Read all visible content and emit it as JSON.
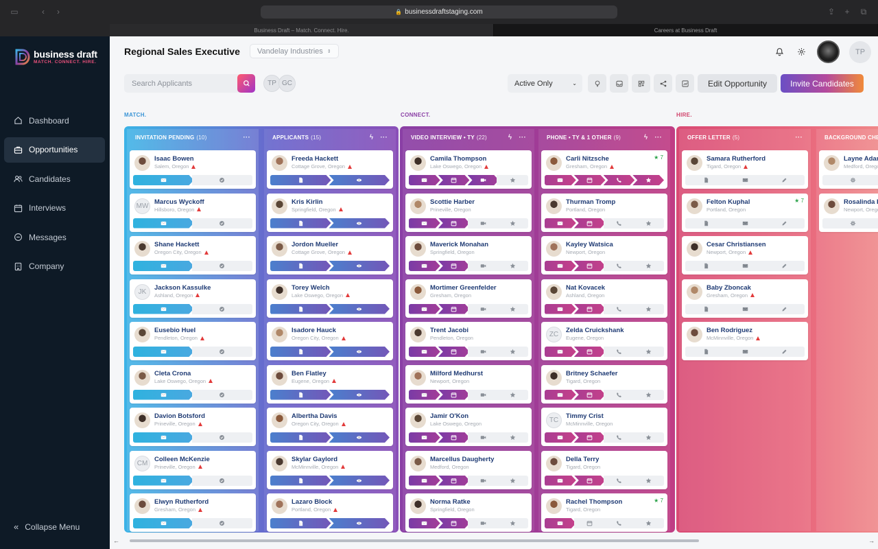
{
  "browser": {
    "url": "businessdraftstaging.com",
    "tabs": [
      "Business Draft – Match. Connect. Hire.",
      "Careers at Business Draft"
    ]
  },
  "brand": {
    "name": "business draft",
    "tagline": "MATCH. CONNECT. HIRE."
  },
  "nav": [
    {
      "label": "Dashboard",
      "icon": "home-icon"
    },
    {
      "label": "Opportunities",
      "icon": "briefcase-icon",
      "active": true
    },
    {
      "label": "Candidates",
      "icon": "users-icon"
    },
    {
      "label": "Interviews",
      "icon": "calendar-icon"
    },
    {
      "label": "Messages",
      "icon": "chat-icon"
    },
    {
      "label": "Company",
      "icon": "building-icon"
    }
  ],
  "collapse_label": "Collapse Menu",
  "header": {
    "title": "Regional Sales Executive",
    "company": "Vandelay Industries",
    "user_initials": "TP"
  },
  "toolbar": {
    "search_placeholder": "Search Applicants",
    "chips": [
      "TP",
      "GC"
    ],
    "filter": "Active Only",
    "edit": "Edit Opportunity",
    "invite": "Invite Candidates"
  },
  "stages": {
    "match": "MATCH.",
    "connect": "CONNECT.",
    "hire": "HIRE."
  },
  "colors": {
    "match": "#3bb3e6",
    "applicants": "#6a57c2",
    "connect": "#8a3fa5",
    "phone": "#b43d8e",
    "hire": "#e05a74"
  },
  "columns": [
    {
      "title": "INVITATION PENDING",
      "count": "(10)",
      "steps": [
        "envelope",
        "check"
      ],
      "active": 1,
      "cards": [
        {
          "name": "Isaac Bowen",
          "loc": "Salem, Oregon",
          "warn": true
        },
        {
          "name": "Marcus Wyckoff",
          "loc": "Hillsboro, Oregon",
          "warn": true,
          "initials": "MW"
        },
        {
          "name": "Shane Hackett",
          "loc": "Oregon City, Oregon",
          "warn": true
        },
        {
          "name": "Jackson Kassulke",
          "loc": "Ashland, Oregon",
          "warn": true,
          "initials": "JK"
        },
        {
          "name": "Eusebio Huel",
          "loc": "Pendleton, Oregon",
          "warn": true
        },
        {
          "name": "Cleta Crona",
          "loc": "Lake Oswego, Oregon",
          "warn": true
        },
        {
          "name": "Davion Botsford",
          "loc": "Prineville, Oregon",
          "warn": true
        },
        {
          "name": "Colleen McKenzie",
          "loc": "Prineville, Oregon",
          "warn": true,
          "initials": "CM"
        },
        {
          "name": "Elwyn Rutherford",
          "loc": "Gresham, Oregon",
          "warn": true
        }
      ]
    },
    {
      "title": "APPLICANTS",
      "count": "(15)",
      "steps": [
        "file",
        "eye"
      ],
      "active": 2,
      "cards": [
        {
          "name": "Freeda Hackett",
          "loc": "Cottage Grove, Oregon",
          "warn": true
        },
        {
          "name": "Kris Kirlin",
          "loc": "Springfield, Oregon",
          "warn": true
        },
        {
          "name": "Jordon Mueller",
          "loc": "Cottage Grove, Oregon",
          "warn": true
        },
        {
          "name": "Torey Welch",
          "loc": "Lake Oswego, Oregon",
          "warn": true
        },
        {
          "name": "Isadore Hauck",
          "loc": "Oregon City, Oregon",
          "warn": true
        },
        {
          "name": "Ben Flatley",
          "loc": "Eugene, Oregon",
          "warn": true
        },
        {
          "name": "Albertha Davis",
          "loc": "Oregon City, Oregon",
          "warn": true
        },
        {
          "name": "Skylar Gaylord",
          "loc": "McMinnville, Oregon",
          "warn": true
        },
        {
          "name": "Lazaro Block",
          "loc": "Portland, Oregon",
          "warn": true
        }
      ]
    },
    {
      "title": "VIDEO INTERVIEW • TY",
      "count": "(22)",
      "steps": [
        "envelope",
        "calendar",
        "video",
        "star"
      ],
      "active": 2,
      "cards": [
        {
          "name": "Camila Thompson",
          "loc": "Lake Oswego, Oregon",
          "warn": true,
          "active": 3
        },
        {
          "name": "Scottie Harber",
          "loc": "Prineville, Oregon"
        },
        {
          "name": "Maverick Monahan",
          "loc": "Springfield, Oregon"
        },
        {
          "name": "Mortimer Greenfelder",
          "loc": "Gresham, Oregon"
        },
        {
          "name": "Trent Jacobi",
          "loc": "Pendleton, Oregon"
        },
        {
          "name": "Milford Medhurst",
          "loc": "Newport, Oregon"
        },
        {
          "name": "Jamir O'Kon",
          "loc": "Lake Oswego, Oregon"
        },
        {
          "name": "Marcellus Daugherty",
          "loc": "Medford, Oregon"
        },
        {
          "name": "Norma Ratke",
          "loc": "Springfield, Oregon"
        }
      ]
    },
    {
      "title": "PHONE • TY & 1 OTHER",
      "count": "(9)",
      "steps": [
        "envelope",
        "calendar",
        "phone",
        "star"
      ],
      "active": 2,
      "cards": [
        {
          "name": "Carli Nitzsche",
          "loc": "Gresham, Oregon",
          "warn": true,
          "active": 4,
          "star": "★ 7"
        },
        {
          "name": "Thurman Tromp",
          "loc": "Portland, Oregon"
        },
        {
          "name": "Kayley Watsica",
          "loc": "Newport, Oregon"
        },
        {
          "name": "Nat Kovacek",
          "loc": "Ashland, Oregon"
        },
        {
          "name": "Zelda Cruickshank",
          "loc": "Eugene, Oregon",
          "initials": "ZC"
        },
        {
          "name": "Britney Schaefer",
          "loc": "Tigard, Oregon"
        },
        {
          "name": "Timmy Crist",
          "loc": "McMinnville, Oregon",
          "initials": "TC"
        },
        {
          "name": "Della Terry",
          "loc": "Tigard, Oregon"
        },
        {
          "name": "Rachel Thompson",
          "loc": "Tigard, Oregon",
          "star": "★ 7",
          "active": 1
        }
      ]
    },
    {
      "title": "OFFER LETTER",
      "count": "(5)",
      "steps": [
        "file",
        "envelope",
        "pencil"
      ],
      "active": 0,
      "cards": [
        {
          "name": "Samara Rutherford",
          "loc": "Tigard, Oregon",
          "warn": true
        },
        {
          "name": "Felton Kuphal",
          "loc": "Portland, Oregon",
          "star": "★ 7"
        },
        {
          "name": "Cesar Christiansen",
          "loc": "Newport, Oregon",
          "warn": true
        },
        {
          "name": "Baby Zboncak",
          "loc": "Gresham, Oregon",
          "warn": true
        },
        {
          "name": "Ben Rodriguez",
          "loc": "McMinnville, Oregon",
          "warn": true
        }
      ]
    },
    {
      "title": "BACKGROUND CHECK",
      "count": "",
      "steps": [
        "gear",
        "envelope"
      ],
      "active": 0,
      "cards": [
        {
          "name": "Layne Adams",
          "loc": "Medford, Oregon"
        },
        {
          "name": "Rosalinda P",
          "loc": "Newport, Oregon"
        }
      ]
    }
  ]
}
